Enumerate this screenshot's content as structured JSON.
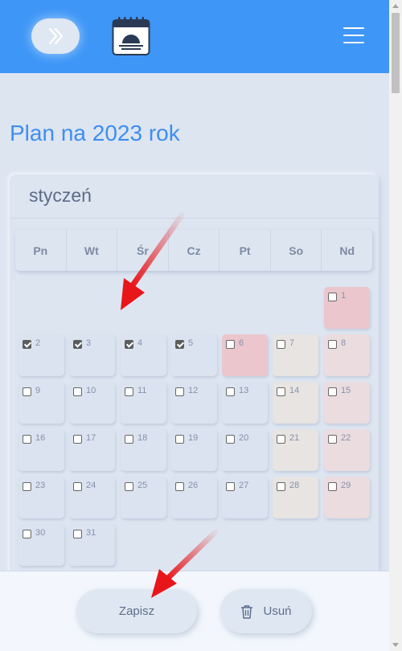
{
  "header": {
    "toggle_icon": "double-chevron-right-icon",
    "logo_icon": "calendar-sunrise-icon",
    "menu_icon": "hamburger-menu-icon",
    "bar_color": "#3e96f7"
  },
  "page": {
    "title": "Plan na 2023 rok"
  },
  "calendar": {
    "month": "styczeń",
    "weekdays": [
      "Pn",
      "Wt",
      "Śr",
      "Cz",
      "Pt",
      "So",
      "Nd"
    ],
    "days": [
      {
        "n": "1",
        "checked": false,
        "kind": "holiday"
      },
      {
        "n": "2",
        "checked": true,
        "kind": "weekday"
      },
      {
        "n": "3",
        "checked": true,
        "kind": "weekday"
      },
      {
        "n": "4",
        "checked": true,
        "kind": "weekday"
      },
      {
        "n": "5",
        "checked": true,
        "kind": "weekday"
      },
      {
        "n": "6",
        "checked": false,
        "kind": "holiday"
      },
      {
        "n": "7",
        "checked": false,
        "kind": "sat"
      },
      {
        "n": "8",
        "checked": false,
        "kind": "sun"
      },
      {
        "n": "9",
        "checked": false,
        "kind": "weekday"
      },
      {
        "n": "10",
        "checked": false,
        "kind": "weekday"
      },
      {
        "n": "11",
        "checked": false,
        "kind": "weekday"
      },
      {
        "n": "12",
        "checked": false,
        "kind": "weekday"
      },
      {
        "n": "13",
        "checked": false,
        "kind": "weekday"
      },
      {
        "n": "14",
        "checked": false,
        "kind": "sat"
      },
      {
        "n": "15",
        "checked": false,
        "kind": "sun"
      },
      {
        "n": "16",
        "checked": false,
        "kind": "weekday"
      },
      {
        "n": "17",
        "checked": false,
        "kind": "weekday"
      },
      {
        "n": "18",
        "checked": false,
        "kind": "weekday"
      },
      {
        "n": "19",
        "checked": false,
        "kind": "weekday"
      },
      {
        "n": "20",
        "checked": false,
        "kind": "weekday"
      },
      {
        "n": "21",
        "checked": false,
        "kind": "sat"
      },
      {
        "n": "22",
        "checked": false,
        "kind": "sun"
      },
      {
        "n": "23",
        "checked": false,
        "kind": "weekday"
      },
      {
        "n": "24",
        "checked": false,
        "kind": "weekday"
      },
      {
        "n": "25",
        "checked": false,
        "kind": "weekday"
      },
      {
        "n": "26",
        "checked": false,
        "kind": "weekday"
      },
      {
        "n": "27",
        "checked": false,
        "kind": "weekday"
      },
      {
        "n": "28",
        "checked": false,
        "kind": "sat"
      },
      {
        "n": "29",
        "checked": false,
        "kind": "sun"
      },
      {
        "n": "30",
        "checked": false,
        "kind": "weekday"
      },
      {
        "n": "31",
        "checked": false,
        "kind": "weekday"
      }
    ],
    "colors": {
      "weekday": "#dbe3f0",
      "sat": "#e7e4e2",
      "sun": "#ebdce0",
      "holiday": "#ebc6cd"
    }
  },
  "actions": {
    "save_label": "Zapisz",
    "delete_label": "Usuń",
    "delete_icon": "trash-icon"
  },
  "annotations": {
    "arrow_color": "#e8161b"
  }
}
